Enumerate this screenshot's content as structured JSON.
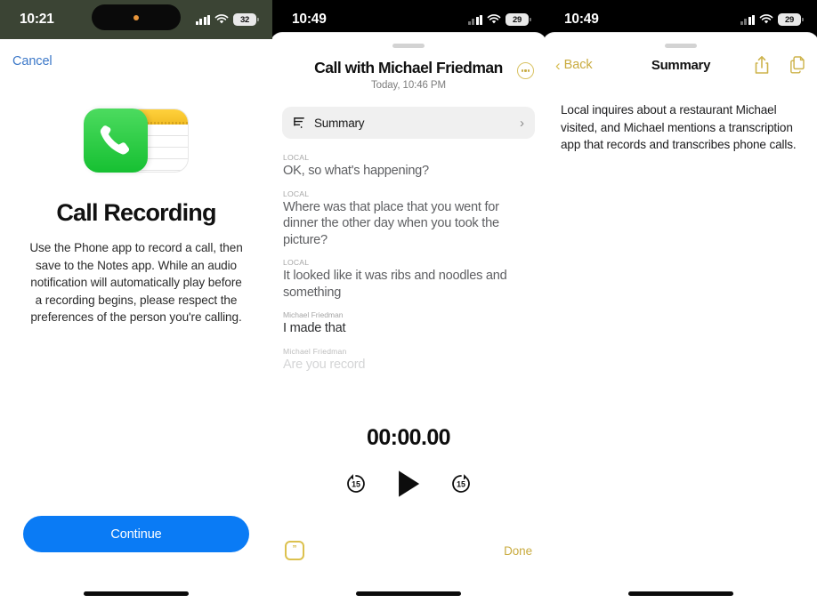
{
  "screen1": {
    "status": {
      "time": "10:21",
      "battery": "32",
      "signal_icon": "cellular-bars-icon",
      "wifi_icon": "wifi-icon",
      "battery_icon": "battery-icon"
    },
    "nav": {
      "cancel_label": "Cancel"
    },
    "icons": {
      "phone_icon": "phone-app-icon",
      "notes_icon": "notes-app-icon"
    },
    "title": "Call Recording",
    "body": "Use the Phone app to record a call, then save to the Notes app. While an audio notification will automatically play before a recording begins, please respect the preferences of the person you're calling.",
    "continue_label": "Continue",
    "accent_color": "#0a7bf5",
    "cancel_color": "#3c78c8"
  },
  "screen2": {
    "status": {
      "time": "10:49",
      "battery": "29"
    },
    "title": "Call with Michael Friedman",
    "subtitle": "Today, 10:46 PM",
    "more_icon": "more-options-icon",
    "summary_row": {
      "label": "Summary",
      "icon": "summary-lines-icon",
      "chevron": "›"
    },
    "transcript": [
      {
        "speaker": "LOCAL",
        "text": "OK, so what's happening?",
        "style": "other"
      },
      {
        "speaker": "LOCAL",
        "text": "Where was that place that you went for dinner the other day when you took the picture?",
        "style": "other"
      },
      {
        "speaker": "LOCAL",
        "text": "It looked like it was ribs and noodles and something",
        "style": "other"
      },
      {
        "speaker": "Michael Friedman",
        "text": "I made that",
        "style": "self"
      },
      {
        "speaker": "Michael Friedman",
        "text": "Are you record",
        "style": "faded"
      }
    ],
    "player": {
      "timer": "00:00.00",
      "skip_back_label": "15",
      "skip_forward_label": "15",
      "play_icon": "play-icon",
      "skip_back_icon": "skip-back-15-icon",
      "skip_forward_icon": "skip-forward-15-icon"
    },
    "footer": {
      "quote_icon": "quote-bubble-icon",
      "done_label": "Done"
    },
    "accent_color": "#c9ab3f"
  },
  "screen3": {
    "status": {
      "time": "10:49",
      "battery": "29"
    },
    "nav": {
      "back_label": "Back",
      "title": "Summary",
      "share_icon": "share-icon",
      "copy_icon": "copy-pages-icon"
    },
    "body": "Local inquires about a restaurant Michael visited, and Michael mentions a transcription app that records and transcribes phone calls.",
    "accent_color": "#c9ab3f"
  }
}
